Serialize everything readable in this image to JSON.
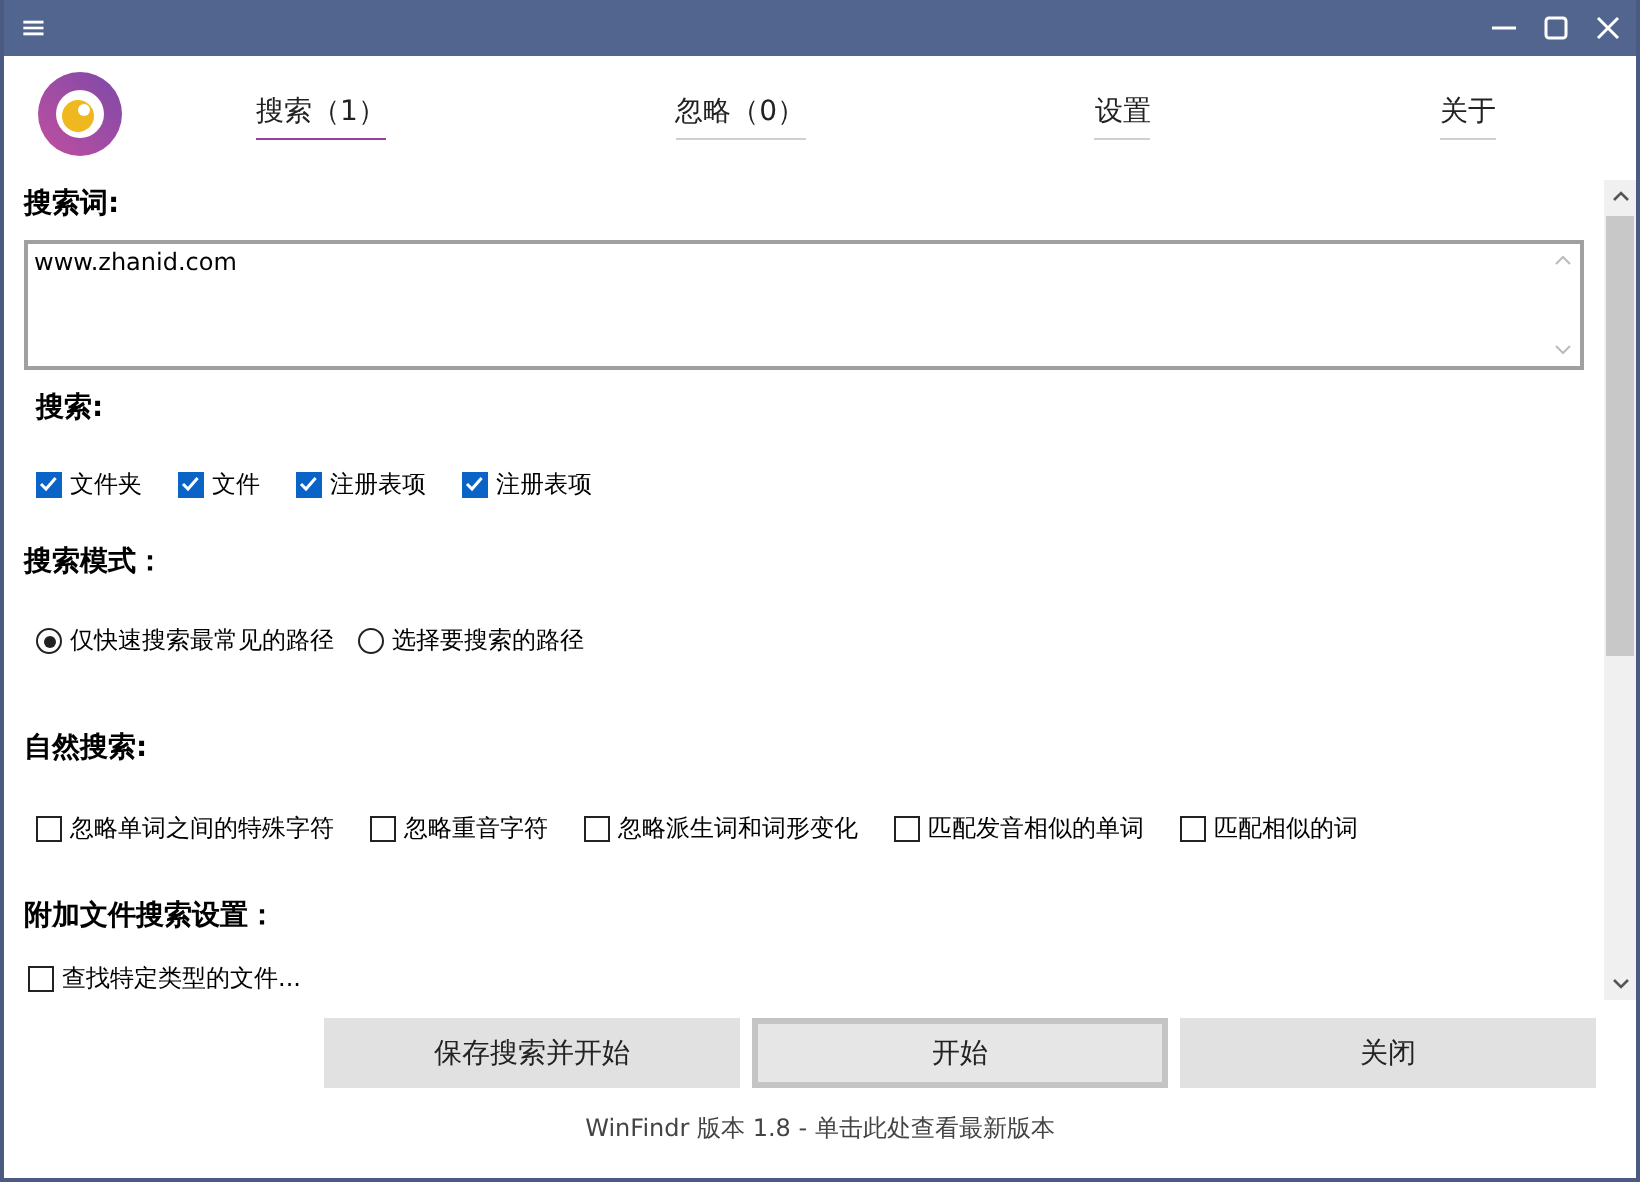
{
  "window": {
    "menu_glyph": "≡"
  },
  "tabs": [
    {
      "label": "搜索（1）",
      "selected": true
    },
    {
      "label": "忽略（0）",
      "selected": false
    },
    {
      "label": "设置",
      "selected": false
    },
    {
      "label": "关于",
      "selected": false
    }
  ],
  "search_term": {
    "label": "搜索词:",
    "value": "www.zhanid.com"
  },
  "search_in": {
    "label": "搜索:",
    "items": [
      {
        "label": "文件夹",
        "checked": true
      },
      {
        "label": "文件",
        "checked": true
      },
      {
        "label": "注册表项",
        "checked": true
      },
      {
        "label": "注册表项",
        "checked": true
      }
    ]
  },
  "search_mode": {
    "label": "搜索模式：",
    "options": [
      {
        "label": "仅快速搜索最常见的路径",
        "selected": true
      },
      {
        "label": "选择要搜索的路径",
        "selected": false
      }
    ]
  },
  "natural_search": {
    "label": "自然搜索:",
    "items": [
      {
        "label": "忽略单词之间的特殊字符",
        "checked": false
      },
      {
        "label": "忽略重音字符",
        "checked": false
      },
      {
        "label": "忽略派生词和词形变化",
        "checked": false
      },
      {
        "label": "匹配发音相似的单词",
        "checked": false
      },
      {
        "label": "匹配相似的词",
        "checked": false
      }
    ]
  },
  "extra_settings": {
    "label": "附加文件搜索设置：",
    "items": [
      {
        "label": "查找特定类型的文件...",
        "checked": false
      }
    ]
  },
  "buttons": [
    {
      "label": "保存搜索并开始",
      "default": false
    },
    {
      "label": "开始",
      "default": true
    },
    {
      "label": "关闭",
      "default": false
    }
  ],
  "footer": "WinFindr 版本 1.8 - 单击此处查看最新版本"
}
